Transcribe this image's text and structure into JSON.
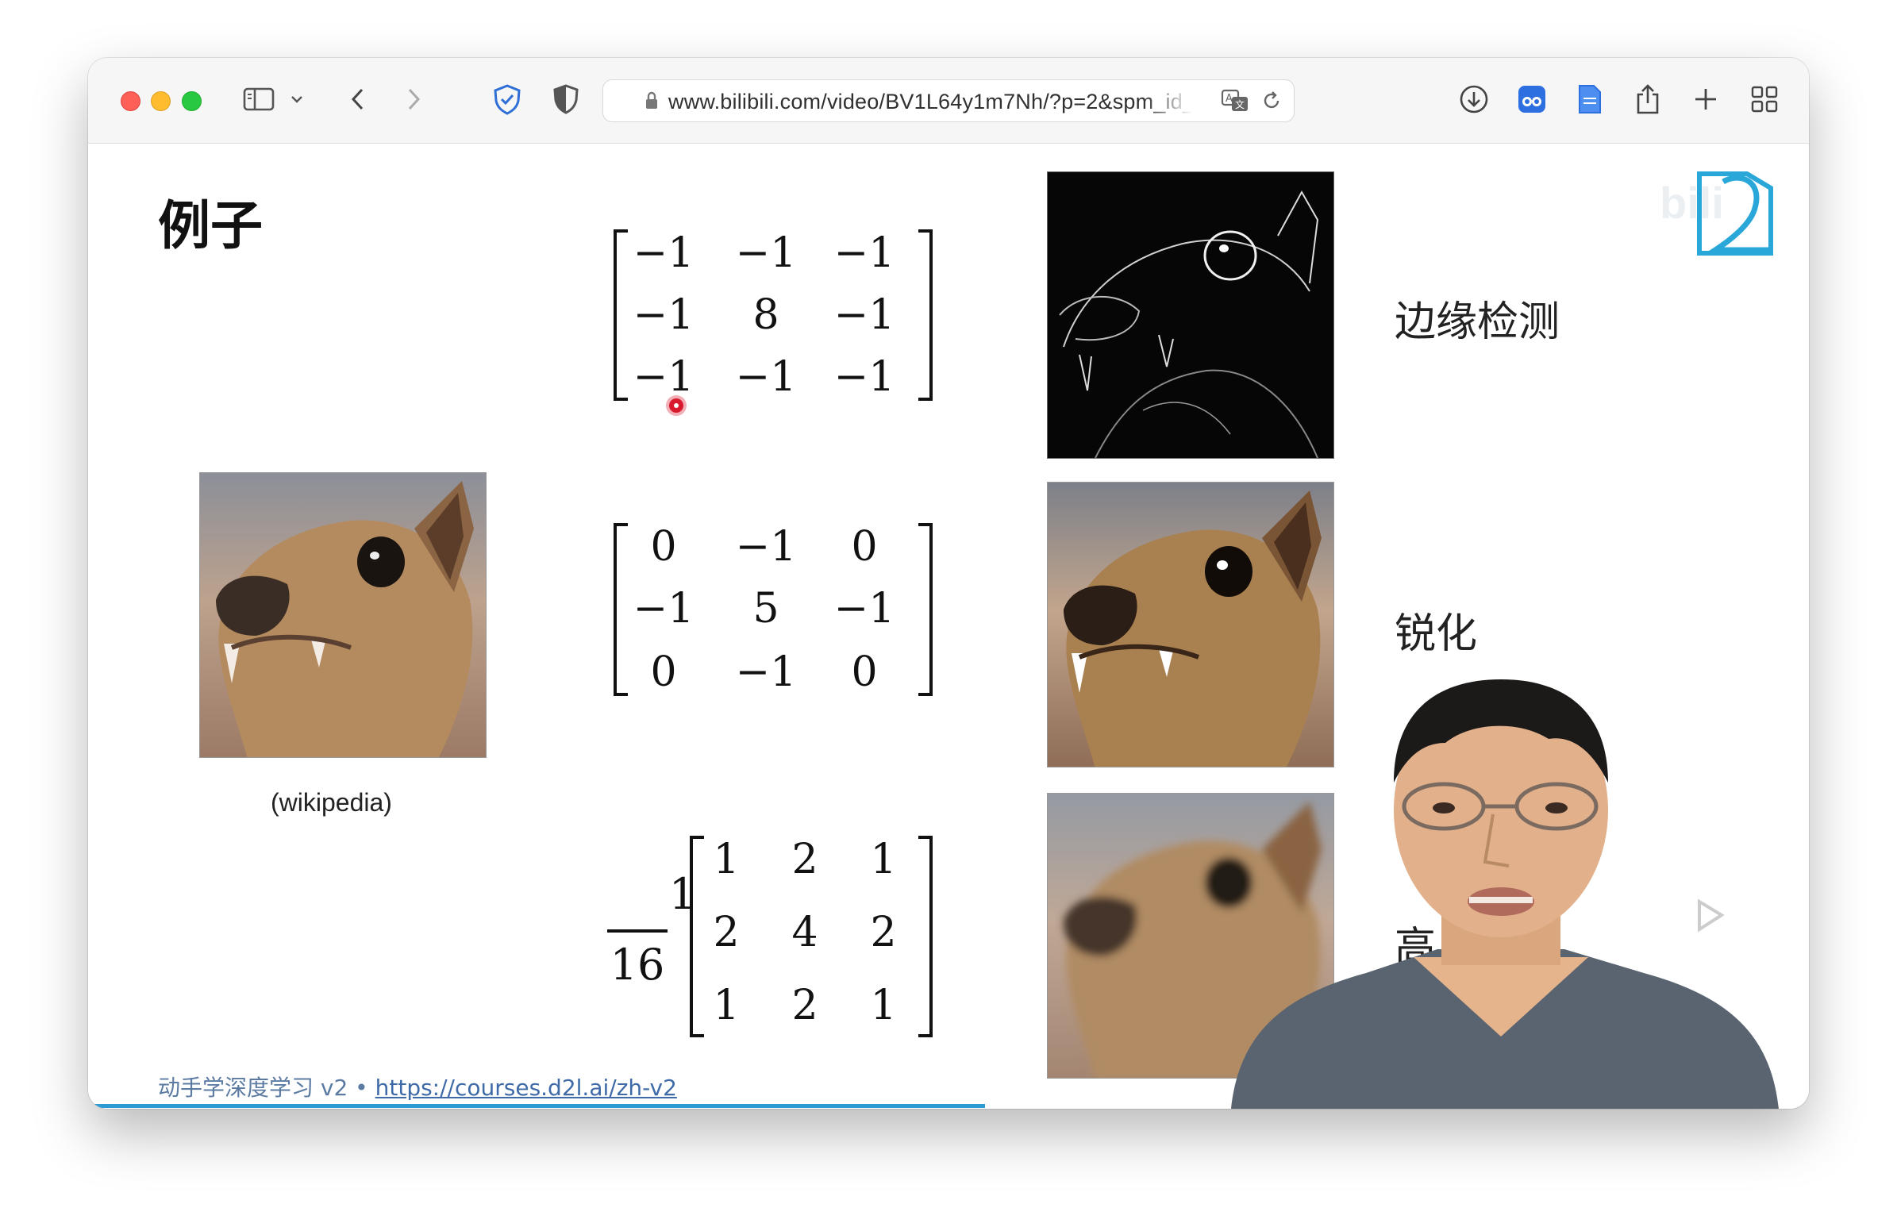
{
  "browser": {
    "url": "www.bilibili.com/video/BV1L64y1m7Nh/?p=2&spm_id_fr",
    "icons": [
      "sidebar-icon",
      "chevron-down-icon",
      "back-icon",
      "forward-icon",
      "shield-check-icon",
      "privacy-shield-icon",
      "lock-icon",
      "translate-icon",
      "reload-icon",
      "download-icon",
      "extension-icon",
      "notes-icon",
      "share-icon",
      "plus-icon",
      "tab-overview-icon"
    ]
  },
  "slide": {
    "title": "例子",
    "caption": "(wikipedia)",
    "matrices": [
      {
        "rows": [
          [
            "−1",
            "−1",
            "−1"
          ],
          [
            "−1",
            "8",
            "−1"
          ],
          [
            "−1",
            "−1",
            "−1"
          ]
        ]
      },
      {
        "rows": [
          [
            "0",
            "−1",
            "0"
          ],
          [
            "−1",
            "5",
            "−1"
          ],
          [
            "0",
            "−1",
            "0"
          ]
        ]
      },
      {
        "prefix_numerator": "1",
        "prefix_denominator": "16",
        "rows": [
          [
            "1",
            "2",
            "1"
          ],
          [
            "2",
            "4",
            "2"
          ],
          [
            "1",
            "2",
            "1"
          ]
        ]
      }
    ],
    "labels": [
      "边缘检测",
      "锐化",
      "高"
    ],
    "footer": {
      "course": "动手学深度学习 v2 • ",
      "link": "https://courses.d2l.ai/zh-v2"
    }
  },
  "colors": {
    "progress": "#2c9ad3",
    "accent_logo": "#2aa7d9",
    "cursor_red": "#d9192d"
  }
}
